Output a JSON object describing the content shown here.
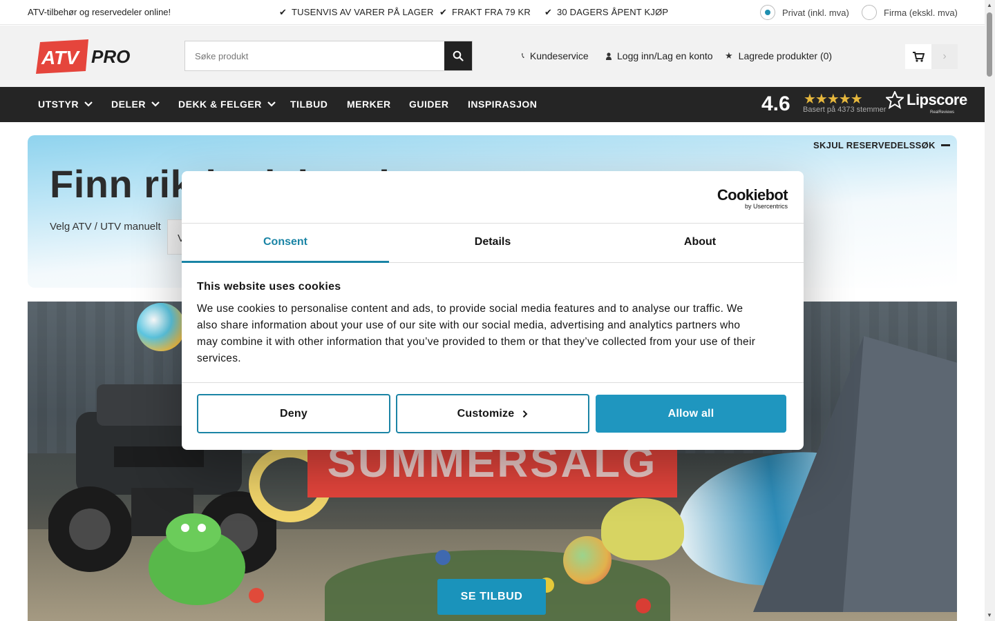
{
  "topbar": {
    "tagline": "ATV-tilbehør og reservedeler online!",
    "usps": [
      "TUSENVIS AV VARER PÅ LAGER",
      "FRAKT FRA 79 KR",
      "30 DAGERS ÅPENT KJØP"
    ],
    "price_options": [
      {
        "label": "Privat (inkl. mva)",
        "selected": true
      },
      {
        "label": "Firma (ekskl. mva)",
        "selected": false
      }
    ]
  },
  "header": {
    "logo_left": "ATV",
    "logo_right": "PRO",
    "search_placeholder": "Søke produkt",
    "links": {
      "customer_service": "Kundeservice",
      "login": "Logg inn/Lag en konto",
      "saved": "Lagrede produkter (0)"
    }
  },
  "nav": {
    "items": [
      "UTSTYR",
      "DELER",
      "DEKK & FELGER",
      "TILBUD",
      "MERKER",
      "GUIDER",
      "INSPIRASJON"
    ],
    "rating": "4.6",
    "stars": "★★★★★",
    "rating_sub": "Basert på 4373 stemmer",
    "lipscore": "Lipscore",
    "lipscore_sub": "RealReviews"
  },
  "finder": {
    "title": "Finn riktig del raskt",
    "label": "Velg ATV / UTV manuelt",
    "select_value": "V",
    "hide_label": "SKJUL RESERVEDELSSØK"
  },
  "hero": {
    "sale_text": "SUMMERSALG",
    "cta": "SE TILBUD"
  },
  "cookie": {
    "brand": "Cookiebot",
    "brand_sub": "by Usercentrics",
    "tabs": [
      "Consent",
      "Details",
      "About"
    ],
    "active_tab": "Consent",
    "title": "This website uses cookies",
    "text": "We use cookies to personalise content and ads, to provide social media features and to analyse our traffic. We also share information about your use of our site with our social media, advertising and analytics partners who may combine it with other information that you’ve provided to them or that they’ve collected from your use of their services.",
    "buttons": {
      "deny": "Deny",
      "customize": "Customize",
      "allow": "Allow all"
    }
  },
  "colors": {
    "accent": "#1a84a5",
    "nav_bg": "#252525",
    "brand_red": "#e5453c",
    "cta_blue": "#1a93bb"
  }
}
